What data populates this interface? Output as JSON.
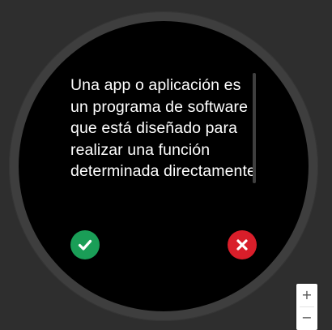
{
  "dialog": {
    "message": "Una app o aplicación es un programa de software que está diseñado para realizar una función determinada directamente para el usuario o, en algunos casos, para otro programa de aplicación."
  },
  "buttons": {
    "accept_icon": "check-icon",
    "accept_color": "#1a9e57",
    "cancel_icon": "close-icon",
    "cancel_color": "#d91e2a"
  },
  "zoom": {
    "in_label": "+",
    "out_label": "−"
  }
}
